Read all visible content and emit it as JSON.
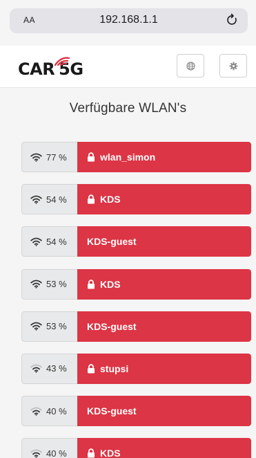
{
  "browser": {
    "reader_label": "AA",
    "url": "192.168.1.1"
  },
  "header": {
    "logo": {
      "car": "CAR",
      "fiveg": "5G"
    },
    "language_icon": "globe-icon",
    "settings_icon": "gear-icon"
  },
  "page": {
    "title": "Verfügbare WLAN's"
  },
  "colors": {
    "accent": "#dc3545",
    "signal_bg": "#e8e9ea"
  },
  "networks": [
    {
      "signal": "77 %",
      "ssid": "wlan_simon",
      "locked": true
    },
    {
      "signal": "54 %",
      "ssid": "KDS",
      "locked": true
    },
    {
      "signal": "54 %",
      "ssid": "KDS-guest",
      "locked": false
    },
    {
      "signal": "53 %",
      "ssid": "KDS",
      "locked": true
    },
    {
      "signal": "53 %",
      "ssid": "KDS-guest",
      "locked": false
    },
    {
      "signal": "43 %",
      "ssid": "stupsi",
      "locked": true
    },
    {
      "signal": "40 %",
      "ssid": "KDS-guest",
      "locked": false
    },
    {
      "signal": "40 %",
      "ssid": "KDS",
      "locked": true
    }
  ]
}
